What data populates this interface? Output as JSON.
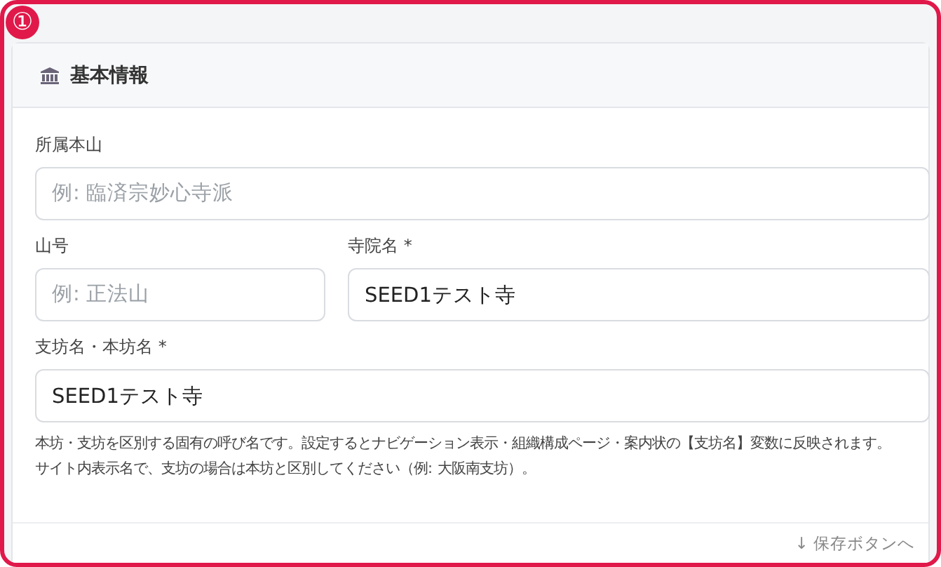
{
  "badge": "①",
  "section": {
    "title": "基本情報"
  },
  "rows": [
    [
      {
        "label": "所属本山",
        "placeholder": "例: 臨済宗妙心寺派"
      }
    ],
    [
      {
        "label": "山号",
        "placeholder": "例: 正法山"
      },
      {
        "label": "寺院名 *",
        "value": "SEED1テスト寺"
      }
    ],
    [
      {
        "label": "支坊名・本坊名 *",
        "value": "SEED1テスト寺"
      }
    ]
  ],
  "help": [
    "本坊・支坊を区別する固有の呼び名です。設定するとナビゲーション表示・組織構成ページ・案内状の【支坊名】変数に反映されます。",
    "サイト内表示名で、支坊の場合は本坊と区別してください（例: 大阪南支坊）。"
  ],
  "footer_link": "↓ 保存ボタンへ"
}
